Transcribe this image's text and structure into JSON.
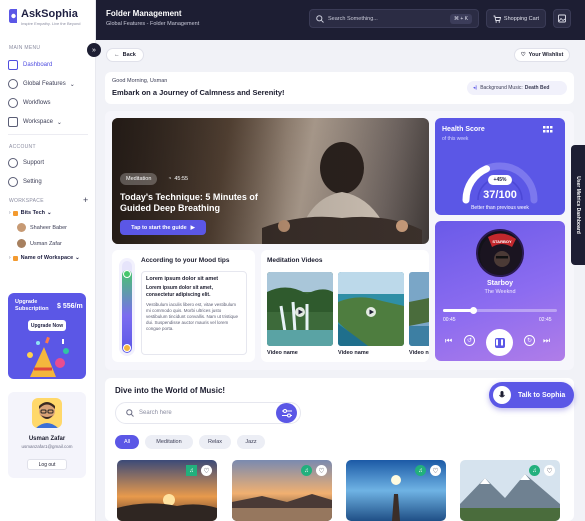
{
  "app": {
    "name": "AskSophia",
    "tagline": "Inspire Empathy. Live the Beyond"
  },
  "sidebar": {
    "main_menu_label": "MAIN MENU",
    "main_items": [
      {
        "label": "Dashboard",
        "icon": "dashboard-icon",
        "active": true
      },
      {
        "label": "Global Features",
        "icon": "globe-icon",
        "caret": true
      },
      {
        "label": "Workflows",
        "icon": "workflow-icon"
      },
      {
        "label": "Workspace",
        "icon": "workspace-icon",
        "caret": true
      }
    ],
    "account_label": "ACCOUNT",
    "account_items": [
      {
        "label": "Support",
        "icon": "support-icon"
      },
      {
        "label": "Setting",
        "icon": "gear-icon"
      }
    ],
    "workspace_label": "WORKSPACE",
    "workspaces": [
      {
        "name": "Bits Tech",
        "members": [
          "Shaheer Baber",
          "Usman Zafar"
        ]
      },
      {
        "name": "Name of Workspace",
        "members": []
      }
    ],
    "upgrade": {
      "title": "Upgrade Subscription",
      "price": "$ 556/m",
      "button": "Upgrade Now"
    },
    "user": {
      "name": "Usman Zafar",
      "email": "usmanzafar1@gmail.com",
      "logout": "Log out"
    }
  },
  "topbar": {
    "title": "Folder Management",
    "breadcrumb": "Global Features - Folder Management",
    "search_placeholder": "Search Something...",
    "search_shortcut": "⌘ + K",
    "cart_label": "Shopping Cart"
  },
  "page": {
    "back": "Back",
    "wishlist": "Your Wishlist",
    "greeting": "Good Morning, Usman",
    "headline": "Embark on a Journey of Calmness and Serenity!",
    "bg_music_label": "Background Music:",
    "bg_music_value": "Death Bed"
  },
  "hero": {
    "tag": "Meditation",
    "duration": "45:55",
    "title": "Today's Technique: 5 Minutes of Guided Deep Breathing",
    "cta": "Tap to start the guide"
  },
  "health": {
    "title": "Health Score",
    "subtitle": "of this week",
    "delta": "+45%",
    "score": "37/100",
    "score_value": 37,
    "note": "Better than previous week"
  },
  "player": {
    "track": "Starboy",
    "artist": "The Weeknd",
    "elapsed": "00:45",
    "total": "02:45",
    "progress_pct": 27
  },
  "mood": {
    "title": "According to your Mood tips",
    "level_pct": 90,
    "tip_title": "Lorem ipsum dolor sit amet",
    "tip_subtitle": "Lorem ipsum dolor sit amet, consectetur adipiscing elit.",
    "tip_body": "Vestibulum iaculis libero est, vitae vestibulum mi commodo quis. Morbi ultrices justo vestibulum tincidunt convallis. Nam ut tristique dui. Suspendisse auctor mauris vel lorem congue porta."
  },
  "videos": {
    "title": "Meditation Videos",
    "items": [
      {
        "name": "Video name"
      },
      {
        "name": "Video name"
      },
      {
        "name": "Video name"
      }
    ]
  },
  "music": {
    "title": "Dive into the World of Music!",
    "search_placeholder": "Search here",
    "chips": [
      "All",
      "Meditation",
      "Relax",
      "Jazz"
    ],
    "active_chip": "All"
  },
  "talk_button": "Talk to Sophia",
  "side_tab": "User Metrics Dashboard",
  "colors": {
    "primary": "#5b57e6",
    "dark": "#1d1e33",
    "accent_green": "#22b07d",
    "workspace_orange": "#f39a2f"
  }
}
